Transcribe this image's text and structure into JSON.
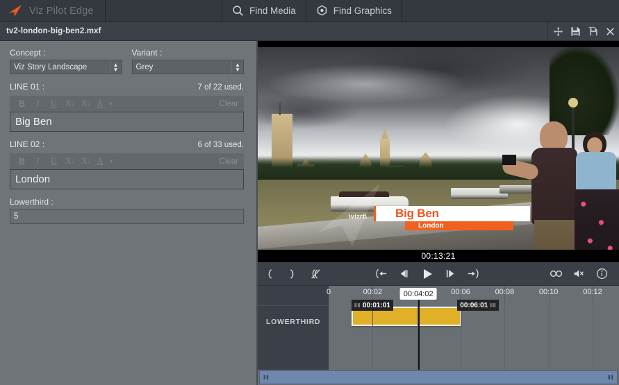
{
  "app": {
    "brand": "Viz Pilot Edge",
    "logo_icon": "vizrt-arrow-logo",
    "tabs": [
      {
        "label": "Find Media",
        "icon": "search-icon"
      },
      {
        "label": "Find Graphics",
        "icon": "graphics-hexagon-icon"
      }
    ]
  },
  "document": {
    "filename": "tv2-london-big-ben2.mxf",
    "tools": [
      {
        "name": "move-icon",
        "label": "Move"
      },
      {
        "name": "save-icon",
        "label": "Save"
      },
      {
        "name": "save-as-icon",
        "label": "Save As"
      },
      {
        "name": "close-icon",
        "label": "Close"
      }
    ]
  },
  "editor": {
    "concept": {
      "label": "Concept :",
      "value": "Viz Story Landscape"
    },
    "variant": {
      "label": "Variant :",
      "value": "Grey"
    },
    "line01": {
      "label": "LINE 01 :",
      "used": "7 of 22 used.",
      "value": "Big Ben",
      "clear_label": "Clear"
    },
    "line02": {
      "label": "LINE 02 :",
      "used": "6 of 33 used.",
      "value": "London",
      "clear_label": "Clear"
    },
    "lowerthird": {
      "label": "Lowerthird :",
      "value": "5"
    },
    "richtext": {
      "bold": "B",
      "italic": "I",
      "underline": "U",
      "subscript_base": "X",
      "subscript_index": "2",
      "superscript_base": "X",
      "superscript_index": "2",
      "color": "A",
      "caret": "▾"
    }
  },
  "player": {
    "timecode": "00:13:21",
    "overlay": {
      "logo_text": "\\vizrt\\",
      "line1": "Big Ben",
      "line2": "London",
      "accent_color": "#f2601f",
      "line1_bg": "#ffffff"
    },
    "transport": [
      {
        "name": "mark-in-icon",
        "label": "Mark In"
      },
      {
        "name": "mark-out-icon",
        "label": "Mark Out"
      },
      {
        "name": "clear-marks-icon",
        "label": "Clear Marks"
      },
      {
        "name": "go-to-in-icon",
        "label": "Go To In"
      },
      {
        "name": "step-back-icon",
        "label": "Step Back"
      },
      {
        "name": "play-icon",
        "label": "Play"
      },
      {
        "name": "step-forward-icon",
        "label": "Step Forward"
      },
      {
        "name": "go-to-out-icon",
        "label": "Go To Out"
      }
    ],
    "right_tools": [
      {
        "name": "loop-icon",
        "label": "Loop"
      },
      {
        "name": "mute-icon",
        "label": "Mute"
      },
      {
        "name": "info-icon",
        "label": "Info"
      }
    ]
  },
  "timeline": {
    "track_label": "LOWERTHIRD",
    "ticks": [
      "0",
      "00:02",
      "00:04",
      "00:06",
      "00:08",
      "00:10",
      "00:12"
    ],
    "tick_positions": [
      0,
      2,
      4,
      6,
      8,
      10,
      12
    ],
    "clip": {
      "in_timecode": "00:01:01",
      "out_timecode": "00:06:01",
      "color": "#e0b028"
    },
    "playhead_timecode": "00:04:02",
    "grip_glyph": "‖‖",
    "range_seconds": [
      0,
      13.2
    ]
  }
}
